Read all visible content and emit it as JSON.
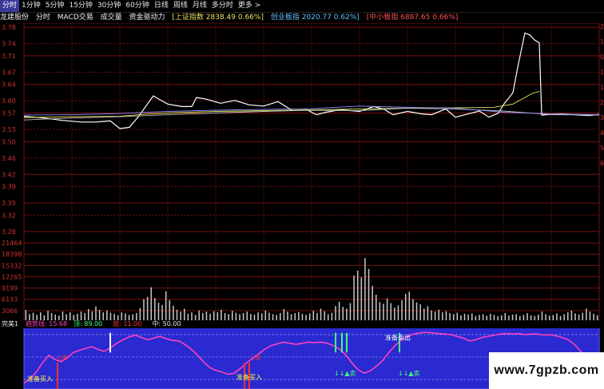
{
  "tabs": [
    {
      "label": "分时",
      "active": true
    },
    {
      "label": "1分钟",
      "active": false
    },
    {
      "label": "5分钟",
      "active": false
    },
    {
      "label": "15分钟",
      "active": false
    },
    {
      "label": "30分钟",
      "active": false
    },
    {
      "label": "60分钟",
      "active": false
    },
    {
      "label": "日线",
      "active": false
    },
    {
      "label": "周线",
      "active": false
    },
    {
      "label": "月线",
      "active": false
    },
    {
      "label": "多分时",
      "active": false
    },
    {
      "label": "更多 >",
      "active": false
    }
  ],
  "infobar": {
    "stock": "龙建股份",
    "items": [
      "分时",
      "MACD交易",
      "成交量",
      "资金驱动力"
    ],
    "sh_index": "[上证指数 2838.49 0.66%]",
    "cy_index": "创业板指 2020.77 0.62%]",
    "zx_index": "[中小板指 6887.65 0.66%]"
  },
  "colors": {
    "background": "#000000",
    "grid": "#7a1010",
    "axis_text": "#d03030",
    "price_line": "#ffffff",
    "avg_line": "#e8e860",
    "volume": "#c8c8c8",
    "indicator_bg": "#2a2ad0",
    "indicator_line": "#ff40c0",
    "signal_green": "#40ff80",
    "signal_red": "#ff3030",
    "buy_label": "#ffff40"
  },
  "chart_data": [
    {
      "type": "line",
      "name": "intraday-price",
      "y_ticks": [
        "3.78",
        "3.74",
        "3.71",
        "3.67",
        "3.64",
        "3.60",
        "3.57",
        "3.53",
        "3.50",
        "3.46",
        "3.42",
        "3.39",
        "3.35",
        "3.32",
        "3.28"
      ],
      "right_ticks": [
        "2",
        "1",
        "0",
        "1",
        "1",
        "2",
        "3",
        "4",
        "5",
        "6"
      ],
      "ylim": [
        3.27,
        3.79
      ],
      "xlim": [
        0,
        240
      ],
      "series": [
        {
          "key": "price",
          "x": [
            0,
            8,
            16,
            24,
            30,
            36,
            40,
            44,
            48,
            52,
            54,
            56,
            60,
            66,
            70,
            72,
            76,
            82,
            88,
            94,
            100,
            106,
            112,
            118,
            122,
            126,
            132,
            140,
            146,
            150,
            154,
            160,
            166,
            170,
            176,
            180,
            186,
            190,
            194,
            198,
            200,
            204,
            206,
            209,
            211,
            213,
            215,
            216,
            220,
            224,
            228,
            232,
            236,
            240
          ],
          "y": [
            3.562,
            3.558,
            3.552,
            3.548,
            3.548,
            3.551,
            3.532,
            3.535,
            3.563,
            3.596,
            3.612,
            3.605,
            3.592,
            3.586,
            3.586,
            3.608,
            3.604,
            3.594,
            3.601,
            3.59,
            3.587,
            3.598,
            3.576,
            3.578,
            3.566,
            3.572,
            3.578,
            3.574,
            3.586,
            3.58,
            3.566,
            3.574,
            3.568,
            3.566,
            3.58,
            3.56,
            3.569,
            3.575,
            3.56,
            3.57,
            3.59,
            3.62,
            3.682,
            3.766,
            3.761,
            3.749,
            3.742,
            3.565,
            3.567,
            3.568,
            3.567,
            3.565,
            3.564,
            3.567
          ]
        },
        {
          "key": "average",
          "x": [
            0,
            20,
            40,
            50,
            60,
            80,
            100,
            120,
            140,
            160,
            180,
            196,
            204,
            208,
            212,
            215
          ],
          "y": [
            3.559,
            3.561,
            3.562,
            3.567,
            3.57,
            3.574,
            3.576,
            3.578,
            3.58,
            3.582,
            3.583,
            3.584,
            3.592,
            3.605,
            3.618,
            3.623
          ]
        },
        {
          "key": "sh-index",
          "x": [
            0,
            20,
            40,
            60,
            80,
            100,
            120,
            140,
            160,
            180,
            200,
            220,
            240
          ],
          "y": [
            3.553,
            3.558,
            3.561,
            3.566,
            3.57,
            3.574,
            3.577,
            3.576,
            3.582,
            3.58,
            3.575,
            3.566,
            3.565
          ]
        },
        {
          "key": "cy-index",
          "x": [
            0,
            20,
            40,
            60,
            80,
            100,
            120,
            140,
            160,
            180,
            200,
            220,
            240
          ],
          "y": [
            3.565,
            3.566,
            3.569,
            3.574,
            3.577,
            3.579,
            3.581,
            3.587,
            3.584,
            3.582,
            3.572,
            3.568,
            3.566
          ]
        }
      ]
    },
    {
      "type": "bar",
      "name": "volume",
      "y_ticks": [
        "21464",
        "18398",
        "15332",
        "12265",
        "9199",
        "6133",
        "3066"
      ],
      "ylim": [
        0,
        23000
      ],
      "values": [
        3200,
        2100,
        2500,
        1900,
        2600,
        1800,
        3000,
        2400,
        2000,
        1700,
        2800,
        2100,
        2600,
        1900,
        2200,
        2800,
        2400,
        3500,
        2900,
        4200,
        3300,
        2600,
        3100,
        2500,
        2200,
        1800,
        2600,
        2300,
        1900,
        2100,
        2400,
        3800,
        6200,
        6800,
        9400,
        6500,
        5200,
        4600,
        8300,
        5900,
        4400,
        3300,
        2800,
        3600,
        2200,
        2600,
        1900,
        3100,
        2400,
        2800,
        2200,
        2900,
        2600,
        3300,
        2400,
        2100,
        3000,
        2500,
        2100,
        2400,
        2800,
        2200,
        2000,
        2600,
        2300,
        3100,
        2500,
        2100,
        1900,
        2400,
        3500,
        2800,
        2100,
        2400,
        2700,
        2200,
        1900,
        2300,
        3000,
        2400,
        3600,
        2900,
        2100,
        2500,
        4300,
        5500,
        4100,
        3600,
        5100,
        12600,
        13900,
        12100,
        17300,
        14400,
        9800,
        7400,
        5400,
        4900,
        6400,
        5100,
        3900,
        4500,
        5900,
        7600,
        8200,
        6200,
        5300,
        4800,
        3600,
        4300,
        3100,
        2800,
        3300,
        2600,
        2900,
        2400,
        2100,
        2500,
        1800,
        2200,
        2000,
        2300,
        1600,
        1900,
        2100,
        1700,
        2200,
        1900,
        1500,
        1800,
        2400,
        1700,
        2000,
        2100,
        1600,
        1900,
        2400,
        1800,
        1600,
        2000,
        2800,
        2100,
        1700,
        1900,
        2300,
        1600,
        2100,
        2600,
        3100,
        2300,
        2000,
        2500,
        3600,
        2800,
        2200,
        1800
      ]
    },
    {
      "type": "line",
      "name": "indicator",
      "title": "完美1",
      "legend": [
        {
          "label": "趋势线: 15.68",
          "color": "#ff40c0"
        },
        {
          "label": "顶: 89.00",
          "color": "#40ff80"
        },
        {
          "label": "底: 11.00",
          "color": "#ff3030"
        },
        {
          "label": "中: 50.00",
          "color": "#e0e0e0"
        }
      ],
      "ylim": [
        0,
        100
      ],
      "reference_lines": [
        89,
        50,
        11
      ],
      "values": [
        5,
        12,
        24,
        40,
        53,
        46,
        42,
        49,
        58,
        62,
        65,
        68,
        63,
        60,
        66,
        74,
        80,
        85,
        88,
        84,
        80,
        83,
        86,
        82,
        79,
        78,
        72,
        64,
        54,
        42,
        32,
        27,
        24,
        20,
        22,
        30,
        40,
        48,
        56,
        64,
        70,
        73,
        76,
        74,
        72,
        74,
        76,
        75,
        76,
        74,
        70,
        64,
        54,
        40,
        28,
        22,
        26,
        34,
        44,
        58,
        70,
        80,
        86,
        90,
        92,
        93,
        92,
        91,
        90,
        89,
        86,
        83,
        78,
        80,
        84,
        86,
        88,
        90,
        91,
        90,
        91,
        89,
        90,
        90,
        88,
        89,
        87,
        84,
        80,
        72,
        60,
        48,
        32,
        16
      ],
      "annotations": [
        "准备买入",
        "准备买入",
        "准备卖出",
        "上涨",
        "上涨"
      ],
      "signal_text": "↓↓▲卖"
    }
  ],
  "watermark": "www.7gpzb.com"
}
